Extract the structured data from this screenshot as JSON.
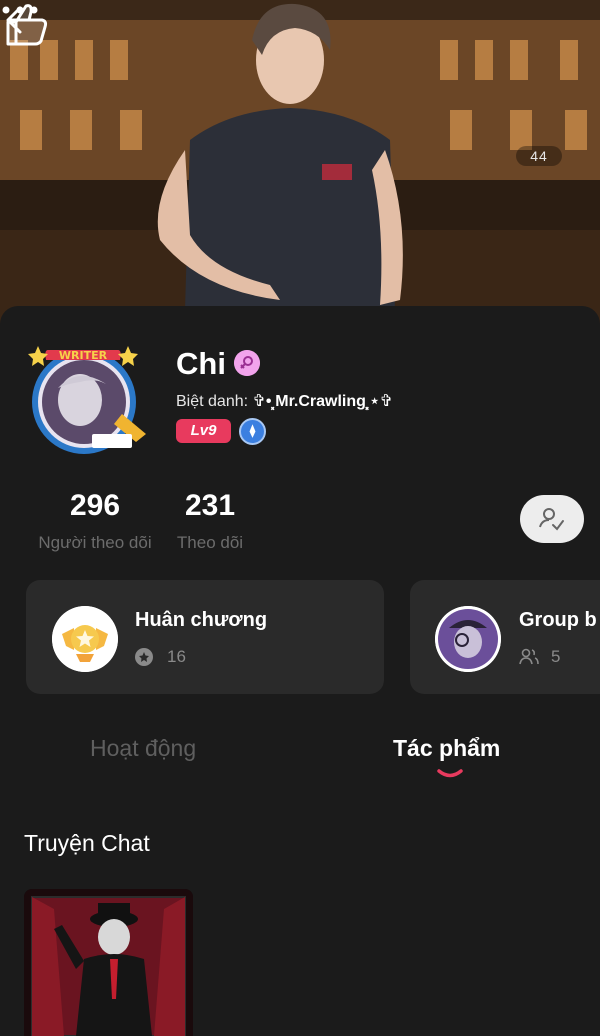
{
  "cover": {
    "like_count": "44",
    "icons": {
      "back": "back-arrow-icon",
      "more": "more-dots-icon",
      "like": "thumbs-up-icon"
    }
  },
  "profile": {
    "name": "Chi",
    "gender_icon": "female-icon",
    "nickname_label": "Biệt danh:",
    "nickname_value": "✞•⸼Mr.Crawling⸼⋆✞",
    "avatar_frame_text": "WRITER",
    "level": "Lv9",
    "verify_icon": "verified-badge-icon"
  },
  "stats": [
    {
      "value": "296",
      "label": "Người theo dõi"
    },
    {
      "value": "231",
      "label": "Theo dõi"
    }
  ],
  "follow_icon": "user-check-icon",
  "boxes": [
    {
      "title": "Huân chương",
      "count": "16",
      "icon": "medal-icon"
    },
    {
      "title": "Group b",
      "count": "5",
      "icon": "users-icon"
    }
  ],
  "tabs": [
    {
      "label": "Hoạt động",
      "active": false
    },
    {
      "label": "Tác phẩm",
      "active": true
    }
  ],
  "section_title": "Truyện Chat",
  "colors": {
    "accent": "#e83a5e",
    "background": "#1b1b1b",
    "card": "#2a2a2a",
    "verify": "#3b7fe0"
  }
}
